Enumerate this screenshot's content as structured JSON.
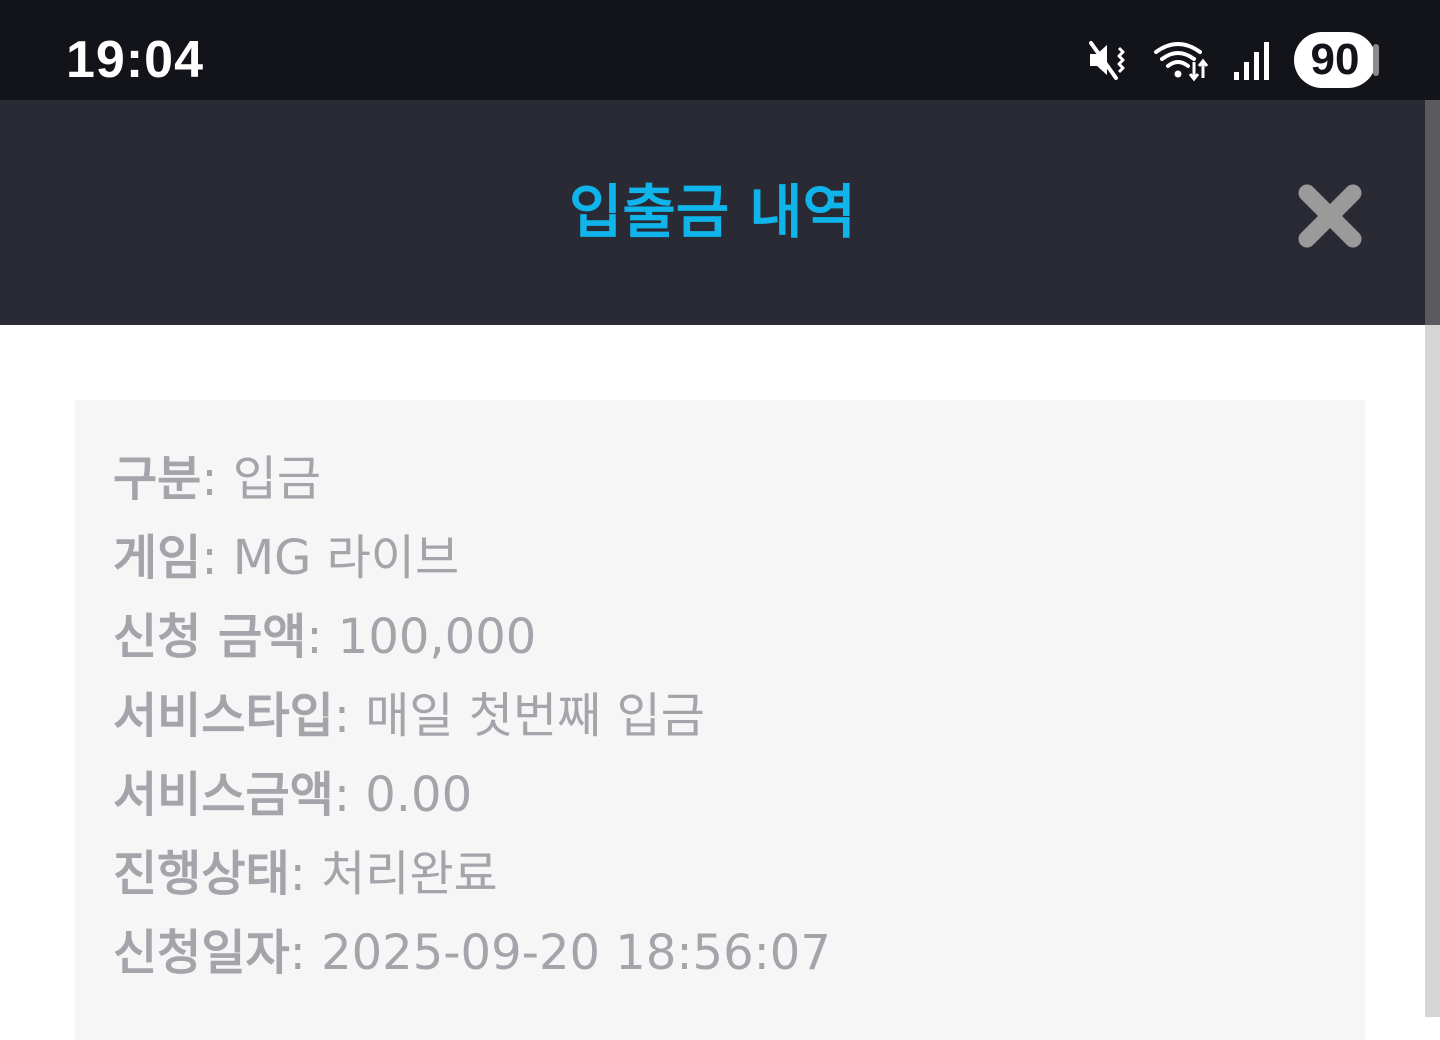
{
  "status_bar": {
    "time": "19:04",
    "battery": "90",
    "icons": [
      "mute-vibrate-icon",
      "wifi-icon",
      "signal-icon",
      "battery-icon"
    ]
  },
  "modal": {
    "title": "입출금 내역",
    "close_icon": "close-icon"
  },
  "details": {
    "separator": ":",
    "rows": [
      {
        "label": "구분",
        "value": "입금"
      },
      {
        "label": "게임",
        "value": "MG 라이브"
      },
      {
        "label": "신청 금액",
        "value": "100,000"
      },
      {
        "label": "서비스타입",
        "value": "매일 첫번째 입금"
      },
      {
        "label": "서비스금액",
        "value": "0.00"
      },
      {
        "label": "진행상태",
        "value": "처리완료"
      },
      {
        "label": "신청일자",
        "value": "2025-09-20 18:56:07"
      }
    ]
  },
  "colors": {
    "status_bar_bg": "#131419",
    "header_bg": "#2a2a35",
    "title": "#0fb4ea",
    "card_bg": "#f6f6f6",
    "text": "#a3a5ab",
    "close_icon": "#9a9a9a"
  }
}
